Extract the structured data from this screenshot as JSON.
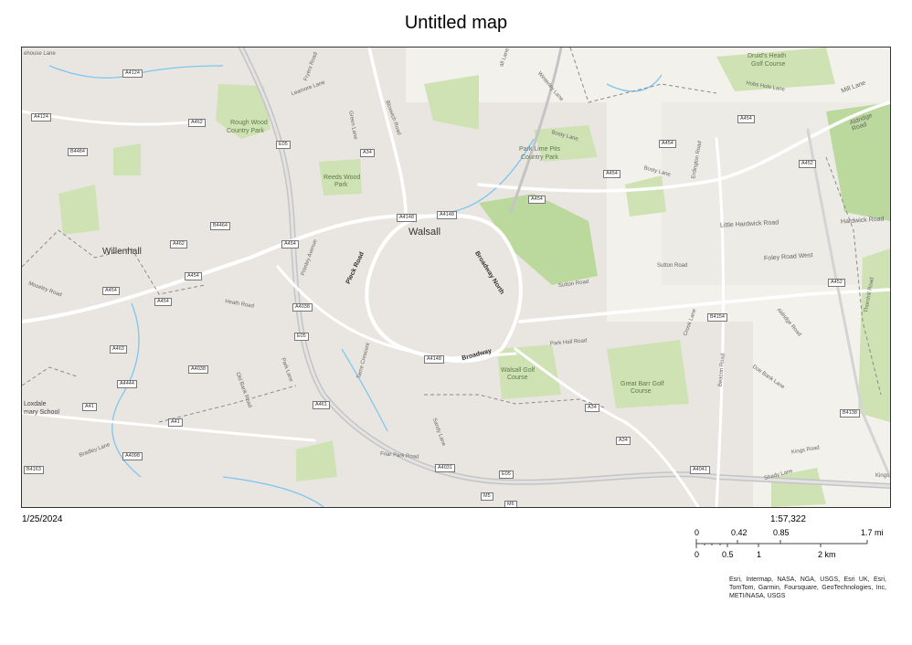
{
  "title": "Untitled map",
  "date": "1/25/2024",
  "scale": "1:57,322",
  "scalebar": {
    "top_ticks": [
      "0",
      "0.42",
      "0.85",
      "1.7 mi"
    ],
    "bottom_ticks": [
      "0",
      "0.5",
      "1",
      "2 km"
    ]
  },
  "attribution": "Esri, Intermap, NASA, NGA, USGS, Esri UK, Esri, TomTom, Garmin, Foursquare, GeoTechnologies, Inc, METI/NASA, USGS",
  "places": {
    "walsall": "Walsall",
    "willenhall": "Willenhall",
    "druids_heath": "Druid's Heath",
    "golf_course": "Golf Course",
    "rough_wood": "Rough Wood",
    "country_park": "Country Park",
    "park_lime_pits": "Park Lime Pits",
    "reeds_wood": "Reeds Wood",
    "park": "Park",
    "walsall_golf": "Walsall Golf",
    "course": "Course",
    "great_barr_golf": "Great Barr Golf",
    "loxdale": "Loxdale",
    "mary_school": "mary School"
  },
  "roads": {
    "broadway_north": "Broadway North",
    "broadway": "Broadway",
    "pleck_road": "Pleck Road",
    "primley_avenue": "Primley Avenue",
    "sutton_road": "Sutton Road",
    "foley_road_west": "Foley Road West",
    "little_hardwick_road": "Little Hardwick Road",
    "hardwick_road": "Hardwick Road",
    "aldridge_road": "Aldridge Road",
    "aldridge_road2": "Aldridge Road",
    "mill_lane": "Mill Lane",
    "hobs_hole_lane": "Hobs Hole Lane",
    "bosty_lane": "Bosty Lane",
    "bosty_lane2": "Bosty Lane",
    "erdington_road": "Erdington Road",
    "park_hall_road": "Park Hall Road",
    "crook_lane": "Crook Lane",
    "beacon_road": "Beacon Road",
    "doe_bank_lane": "Doe Bank Lane",
    "kings_road": "Kings Road",
    "shady_lane": "Shady Lane",
    "friar_park_road": "Friar Park Road",
    "sandy_lane": "Sandy Lane",
    "heath_road": "Heath Road",
    "park_lane": "Park Lane",
    "old_bank_road": "Old Bank Road",
    "fryers_road": "Fryers Road",
    "leamore_lane": "Leamore Lane",
    "bloxwich_road": "Bloxwich Road",
    "green_lane": "Green Lane",
    "moseley_road": "Moseley Road",
    "bradley_lane": "Bradley Lane",
    "lane_top": "all Lane",
    "thornhill_road": "Thornhill Road",
    "whitehouse_lane": "ehouse Lane",
    "winterley_lane": "Winterley Lane",
    "tame_crescent": "Tame Crescent",
    "kings": "Kings"
  },
  "shields": {
    "a4124_1": "A4124",
    "a4124_2": "A4124",
    "a462_1": "A462",
    "a462_2": "A462",
    "b4484": "B4484",
    "e05_1": "E05",
    "e05_2": "E05",
    "e05_3": "E05",
    "a34_1": "A34",
    "a34_2": "A34",
    "a34_3": "A34",
    "a4148_1": "A4148",
    "a4148_2": "A4148",
    "a4148_3": "A4148",
    "b4464": "B4464",
    "a454_1": "A454",
    "a454_2": "A454",
    "a454_3": "A454",
    "a454_4": "A454",
    "a454_5": "A454",
    "a454_6": "A454",
    "a454_7": "A454",
    "a454_8": "A454",
    "a4038_1": "A4038",
    "a4038_2": "A4038",
    "a463": "A463",
    "a4444": "A4444",
    "a41_1": "A41",
    "a41_2": "A41",
    "a4098": "A4098",
    "b4163": "B4163",
    "a461": "A461",
    "a4031": "A4031",
    "a452_1": "A452",
    "a452_2": "A452",
    "b4154": "B4154",
    "b4138": "B4138",
    "a4041": "A4041",
    "m5": "M5",
    "m6": "M6"
  },
  "colors": {
    "land": "#f3f1ec",
    "green": "#cfe2b4",
    "green_dark": "#bcd99d",
    "urban": "#e9e6e1",
    "water": "#7fc6ef",
    "motorway": "#c9c9c9",
    "road": "#ffffff",
    "boundary": "#8a8a8a",
    "label": "#555555"
  }
}
